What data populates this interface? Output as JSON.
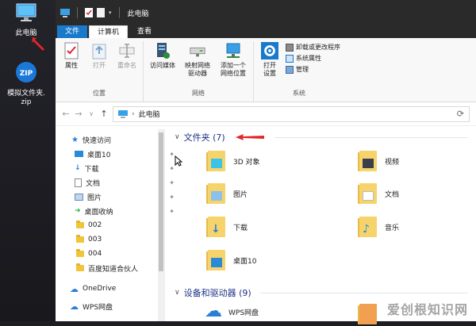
{
  "desktop": {
    "icons": [
      {
        "label": "此电脑"
      },
      {
        "label_line1": "模拟文件夹.",
        "label_line2": "zip",
        "zip_text": "ZIP"
      }
    ]
  },
  "window": {
    "title": "此电脑",
    "tabs": [
      {
        "label": "文件"
      },
      {
        "label": "计算机"
      },
      {
        "label": "查看"
      }
    ]
  },
  "ribbon": {
    "location": {
      "label": "位置",
      "buttons": [
        {
          "label": "属性"
        },
        {
          "label": "打开"
        },
        {
          "label": "重命名"
        }
      ]
    },
    "network": {
      "label": "网络",
      "buttons": [
        {
          "line1": "访问媒体",
          "line2": ""
        },
        {
          "line1": "映射网络",
          "line2": "驱动器"
        },
        {
          "line1": "添加一个",
          "line2": "网络位置"
        }
      ]
    },
    "system": {
      "label": "系统",
      "open_settings": {
        "line1": "打开",
        "line2": "设置"
      },
      "small": [
        {
          "label": "卸载或更改程序"
        },
        {
          "label": "系统属性"
        },
        {
          "label": "管理"
        }
      ]
    }
  },
  "address": {
    "path": "此电脑"
  },
  "sidebar": {
    "quick_access": "快速访问",
    "items": [
      {
        "label": "桌面10"
      },
      {
        "label": "下载"
      },
      {
        "label": "文档"
      },
      {
        "label": "图片"
      },
      {
        "label": "桌面收纳"
      },
      {
        "label": "002"
      },
      {
        "label": "003"
      },
      {
        "label": "004"
      },
      {
        "label": "百度知道合伙人"
      }
    ],
    "onedrive": "OneDrive",
    "wps": "WPS网盘"
  },
  "main": {
    "folders_header": "文件夹 (7)",
    "folders": [
      {
        "label": "3D 对象"
      },
      {
        "label": "视频"
      },
      {
        "label": "图片"
      },
      {
        "label": "文档"
      },
      {
        "label": "下载"
      },
      {
        "label": "音乐"
      },
      {
        "label": "桌面10"
      }
    ],
    "devices_header": "设备和驱动器 (9)",
    "devices": [
      {
        "label": "WPS网盘"
      }
    ]
  },
  "watermark": "爱创根知识网",
  "colors": {
    "accent": "#1979ca",
    "folder": "#f6d46b",
    "arrow": "#e0262b"
  }
}
